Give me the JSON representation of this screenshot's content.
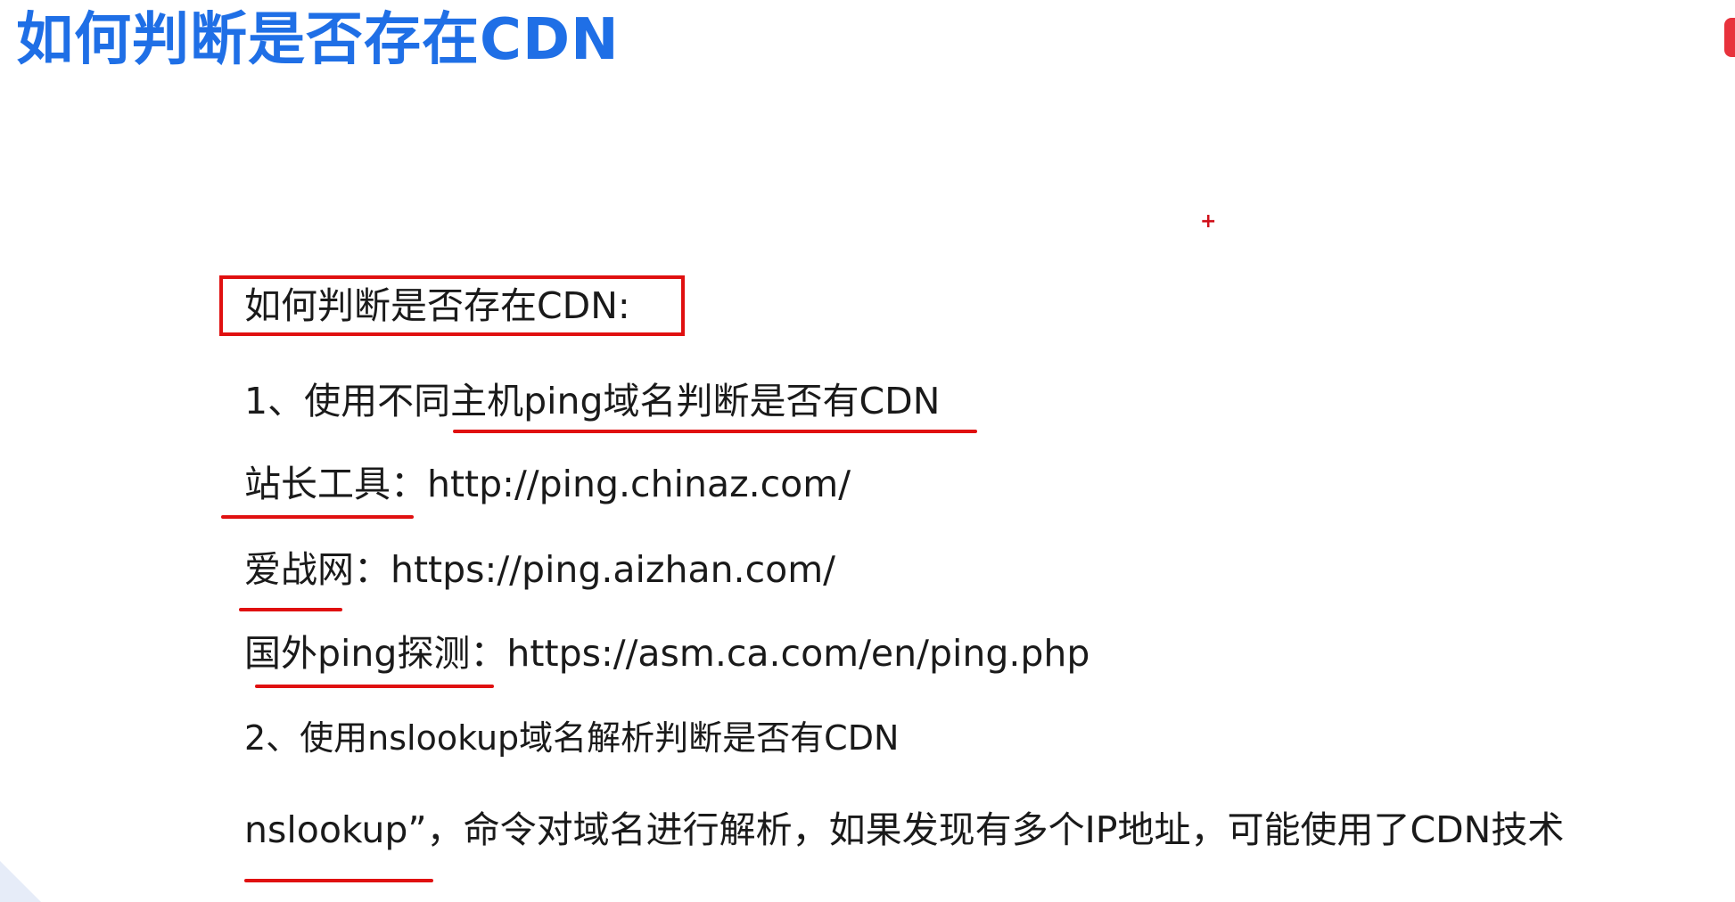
{
  "slide": {
    "title": "如何判断是否存在CDN"
  },
  "content": {
    "boxed_heading": "如何判断是否存在CDN:",
    "method1": "1、使用不同主机ping域名判断是否有CDN",
    "tool1": "站长工具：http://ping.chinaz.com/",
    "tool2": "爱战网：https://ping.aizhan.com/",
    "tool3": "国外ping探测：https://asm.ca.com/en/ping.php",
    "method2": "2、使用nslookup域名解析判断是否有CDN",
    "nslookup_note": "nslookup”，命令对域名进行解析，如果发现有多个IP地址，可能使用了CDN技术"
  },
  "colors": {
    "title": "#1f6fe6",
    "annotation_red": "#e01010",
    "body_text": "#1a1a1a"
  }
}
